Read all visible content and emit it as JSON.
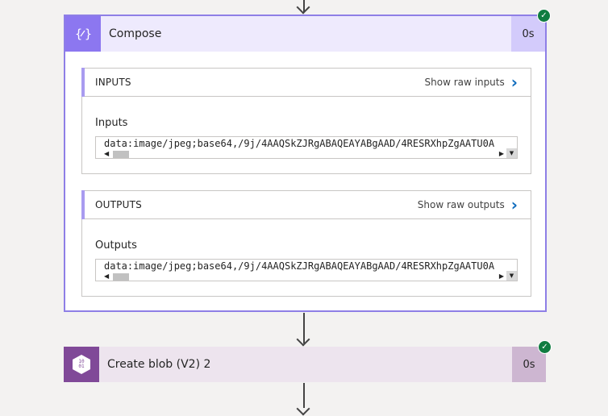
{
  "compose": {
    "title": "Compose",
    "duration": "0s",
    "icon": "curly-braces-icon",
    "inputs_section": {
      "title": "INPUTS",
      "raw_link": "Show raw inputs",
      "field_label": "Inputs",
      "field_value": "data:image/jpeg;base64,/9j/4AAQSkZJRgABAQEAYABgAAD/4RESRXhpZgAATU0A"
    },
    "outputs_section": {
      "title": "OUTPUTS",
      "raw_link": "Show raw outputs",
      "field_label": "Outputs",
      "field_value": "data:image/jpeg;base64,/9j/4AAQSkZJRgABAQEAYABgAAD/4RESRXhpZgAATU0A"
    }
  },
  "create_blob": {
    "title": "Create blob (V2) 2",
    "duration": "0s",
    "icon": "blob-storage-icon",
    "icon_text": "10\n01"
  },
  "colors": {
    "compose_accent": "#8c77f0",
    "blob_accent": "#804998",
    "success": "#107c41",
    "link": "#0f6cbd"
  }
}
